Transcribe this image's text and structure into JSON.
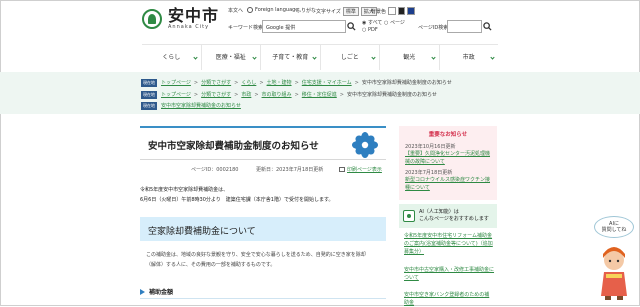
{
  "header": {
    "logo_jp": "安中市",
    "logo_en": "Annaka City",
    "utility": {
      "text_only": "本文へ",
      "foreign_language": "Foreign language",
      "furigana": "ふりがな",
      "fontsize_label": "文字サイズ",
      "fontsize_standard": "標準",
      "fontsize_large": "拡大",
      "color_label": "背景色"
    },
    "keyword_search": {
      "label": "キーワード検索",
      "placeholder": "Google 提供"
    },
    "radio": {
      "all": "すべて",
      "page": "ページ",
      "pdf": "PDF"
    },
    "page_id_search": {
      "label": "ページID検索",
      "placeholder": ""
    }
  },
  "nav": {
    "items": [
      "くらし",
      "医療・福祉",
      "子育て・教育",
      "しごと",
      "観光",
      "市政"
    ]
  },
  "breadcrumbs": {
    "badge_1": "現在地",
    "badge_2": "現在地",
    "badge_3": "現在地",
    "row1": [
      "トップページ",
      "分類でさがす",
      "くらし",
      "土地・建物",
      "住宅支援・マイホーム"
    ],
    "row1_current": "安中市空家除却費補助金制度のお知らせ",
    "row2": [
      "トップページ",
      "分類でさがす",
      "市政",
      "市の取り組み",
      "移住・定住促進"
    ],
    "row2_current": "安中市空家除却費補助金制度のお知らせ",
    "row3": [
      "安中市空家除却費補助金のお知らせ"
    ]
  },
  "main": {
    "title": "安中市空家除却費補助金制度のお知らせ",
    "page_id": "ページID：0002180",
    "updated": "更新日：2023年7月18日更新",
    "print": "印刷ページ表示",
    "intro_1": "令和5年度安中市空家除却費補助金は、",
    "intro_2": "6月6日（火曜日）午前8時30分より　建築住宅課（本庁舎1階）で受付を開始します。",
    "section_title": "空家除却費補助金について",
    "para_1": "この補助金は、地域の良好な景観を守り、安全で安心な暮らしを送るため、自発的に空き家を除却",
    "para_2": "（解体）する人に、その費用の一部を補助するものです。",
    "sub_title": "補助金額"
  },
  "sidebar": {
    "important_title": "重要なお知らせ",
    "items": [
      {
        "date": "2023年10月16日更新",
        "link": "【重要】久間浄化センター汚泥処理機械の故障について"
      },
      {
        "date": "2023年7月18日更新",
        "link": "新型コロナウイルス感染症ワクチン接種について"
      }
    ],
    "ai_line1": "AI（人工知能）は",
    "ai_line2": "こんなページをおすすめします",
    "related": [
      "令和5年度安中市住宅リフォーム補助金のご案内(浴室補助金等について)（追加募集分）",
      "安中市中古空家購入・改修工事補助金について",
      "安中市空き家バンク登録者のための補助金"
    ]
  },
  "mascot": {
    "bubble_line1": "AIに",
    "bubble_line2": "質問してね"
  }
}
